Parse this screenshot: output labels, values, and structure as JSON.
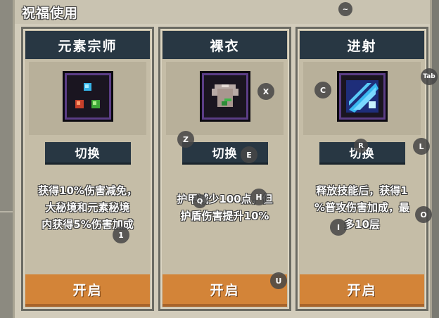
{
  "panel": {
    "title": "祝福使用"
  },
  "cards": [
    {
      "title": "元素宗师",
      "icon": "elements-orb-icon",
      "switch_label": "切换",
      "desc_lines": [
        "获得10%伤害减免，",
        "大秘境和元素秘境",
        "内获得5%伤害加成"
      ],
      "open_label": "开启"
    },
    {
      "title": "裸衣",
      "icon": "bare-shirt-icon",
      "switch_label": "切换",
      "desc_lines": [
        "护甲减少100点，但",
        "护盾伤害提升10%"
      ],
      "open_label": "开启"
    },
    {
      "title": "进射",
      "icon": "burst-shot-icon",
      "switch_label": "切换",
      "desc_lines": [
        "释放技能后，获得1",
        "%普攻伤害加成，最",
        "多10层"
      ],
      "open_label": "开启"
    }
  ],
  "markers": [
    "~",
    "Tab",
    "X",
    "C",
    "Z",
    "E",
    "R",
    "L",
    "Q",
    "H",
    "I",
    "O",
    "1",
    "U"
  ]
}
